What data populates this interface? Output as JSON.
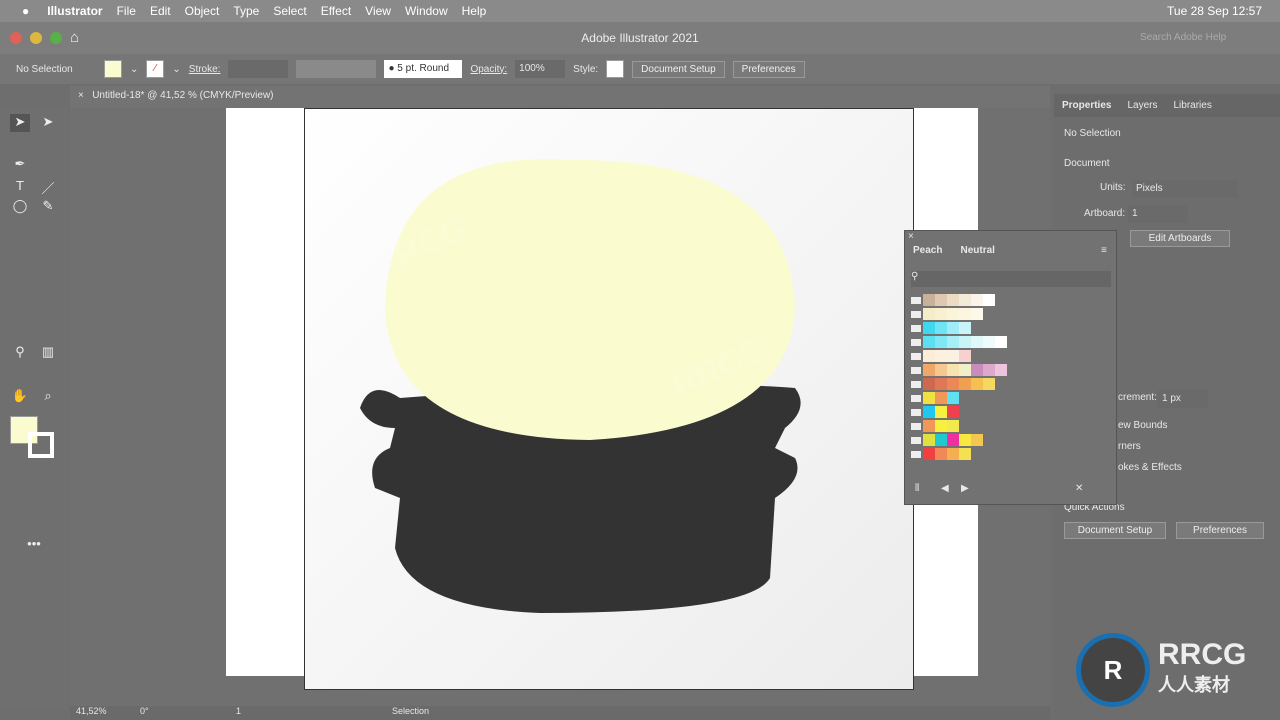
{
  "menubar": {
    "apple": "",
    "app": "Illustrator",
    "items": [
      "File",
      "Edit",
      "Object",
      "Type",
      "Select",
      "Effect",
      "View",
      "Window",
      "Help"
    ],
    "clock": "Tue 28 Sep  12:57"
  },
  "titlebar": {
    "title": "Adobe Illustrator 2021",
    "search_placeholder": "Search Adobe Help"
  },
  "control": {
    "selection": "No Selection",
    "fill_color": "#fbfbd0",
    "stroke_label": "Stroke:",
    "brush": "5 pt. Round",
    "opacity_label": "Opacity:",
    "opacity": "100%",
    "style_label": "Style:",
    "document_setup": "Document Setup",
    "preferences": "Preferences"
  },
  "doc_tab": {
    "close": "×",
    "title": "Untitled-18* @ 41,52 % (CMYK/Preview)"
  },
  "status": {
    "zoom": "41,52%",
    "rotation": "0°",
    "artboard": "1",
    "tool": "Selection"
  },
  "properties": {
    "tabs": [
      "Properties",
      "Layers",
      "Libraries"
    ],
    "selection": "No Selection",
    "document": "Document",
    "units_label": "Units:",
    "units": "Pixels",
    "artboard_label": "Artboard:",
    "artboard": "1",
    "edit_artboards": "Edit Artboards",
    "increment_label": "crement:",
    "increment": "1 px",
    "view_bounds": "ew Bounds",
    "corners": "rners",
    "strokes_effects": "okes & Effects",
    "quick_actions": "Quick Actions",
    "document_setup": "Document Setup",
    "preferences": "Preferences"
  },
  "swatches": {
    "tabs": [
      "Peach",
      "Neutral"
    ],
    "rows": [
      [
        "#c8b09a",
        "#e0c8b0",
        "#ecdcc4",
        "#f4ead8",
        "#faf4ea",
        "#ffffff"
      ],
      [
        "#f6ecc8",
        "#f8f0d0",
        "#faf4d8",
        "#fcf6e0",
        "#fcf8ea"
      ],
      [
        "#40d8f0",
        "#70e4f4",
        "#a0ecf8",
        "#c8f4fa"
      ],
      [
        "#5ce0f0",
        "#80e8f4",
        "#a8eef6",
        "#c8f4f8",
        "#e0f8fa",
        "#f0fcfc",
        "#ffffff"
      ],
      [
        "#fcecd8",
        "#fcf0e0",
        "#faf0e4",
        "#f8d0d0"
      ],
      [
        "#f0a868",
        "#f4c890",
        "#f6e4b0",
        "#f0f0c8",
        "#c88cbc",
        "#dca8cc",
        "#ecc4dc"
      ],
      [
        "#d06850",
        "#e07858",
        "#ec8858",
        "#f0a050",
        "#f4c050",
        "#f4d860"
      ],
      [
        "#f0e040",
        "#f09858",
        "#60e0f0"
      ],
      [
        "#20c8f0",
        "#f8f040",
        "#f04050"
      ],
      [
        "#f09858",
        "#f8f040",
        "#f4e850"
      ],
      [
        "#e0e040",
        "#20c8d0",
        "#f030a0",
        "#f8e840",
        "#f4c850"
      ],
      [
        "#f04040",
        "#f08858",
        "#f4b050",
        "#f4e050"
      ]
    ]
  },
  "watermark": {
    "logo_text": "RRCG",
    "logo_sub": "人人素材"
  },
  "colors": {
    "bun": "#fbfbd0",
    "patty": "#333333",
    "artboard": "#ffffff"
  }
}
